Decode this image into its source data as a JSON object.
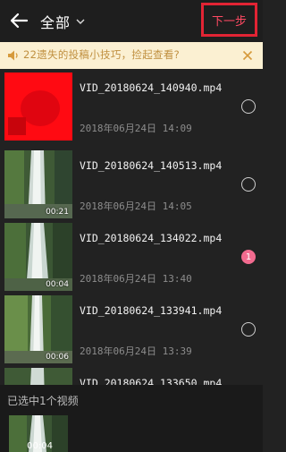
{
  "header": {
    "title": "全部",
    "next_label": "下一步"
  },
  "tip": {
    "text": "22遗失的投稿小技巧，捡起查看?"
  },
  "videos": [
    {
      "name": "VID_20180624_140940.mp4",
      "date": "2018年06月24日 14:09",
      "duration": "",
      "selected": false
    },
    {
      "name": "VID_20180624_140513.mp4",
      "date": "2018年06月24日 14:05",
      "duration": "00:21",
      "selected": false
    },
    {
      "name": "VID_20180624_134022.mp4",
      "date": "2018年06月24日 13:40",
      "duration": "00:04",
      "selected": true,
      "selected_index": "1"
    },
    {
      "name": "VID_20180624_133941.mp4",
      "date": "2018年06月24日 13:39",
      "duration": "00:06",
      "selected": false
    },
    {
      "name": "VID_20180624_133650.mp4",
      "date": "",
      "duration": "",
      "selected": false
    }
  ],
  "bottom": {
    "selected_label": "已选中1个视频",
    "selected_duration": "00:04"
  },
  "colors": {
    "accent": "#e22434",
    "selected_badge": "#f26b8f",
    "tip_bg": "#fbf0d2",
    "tip_text": "#c09040"
  }
}
